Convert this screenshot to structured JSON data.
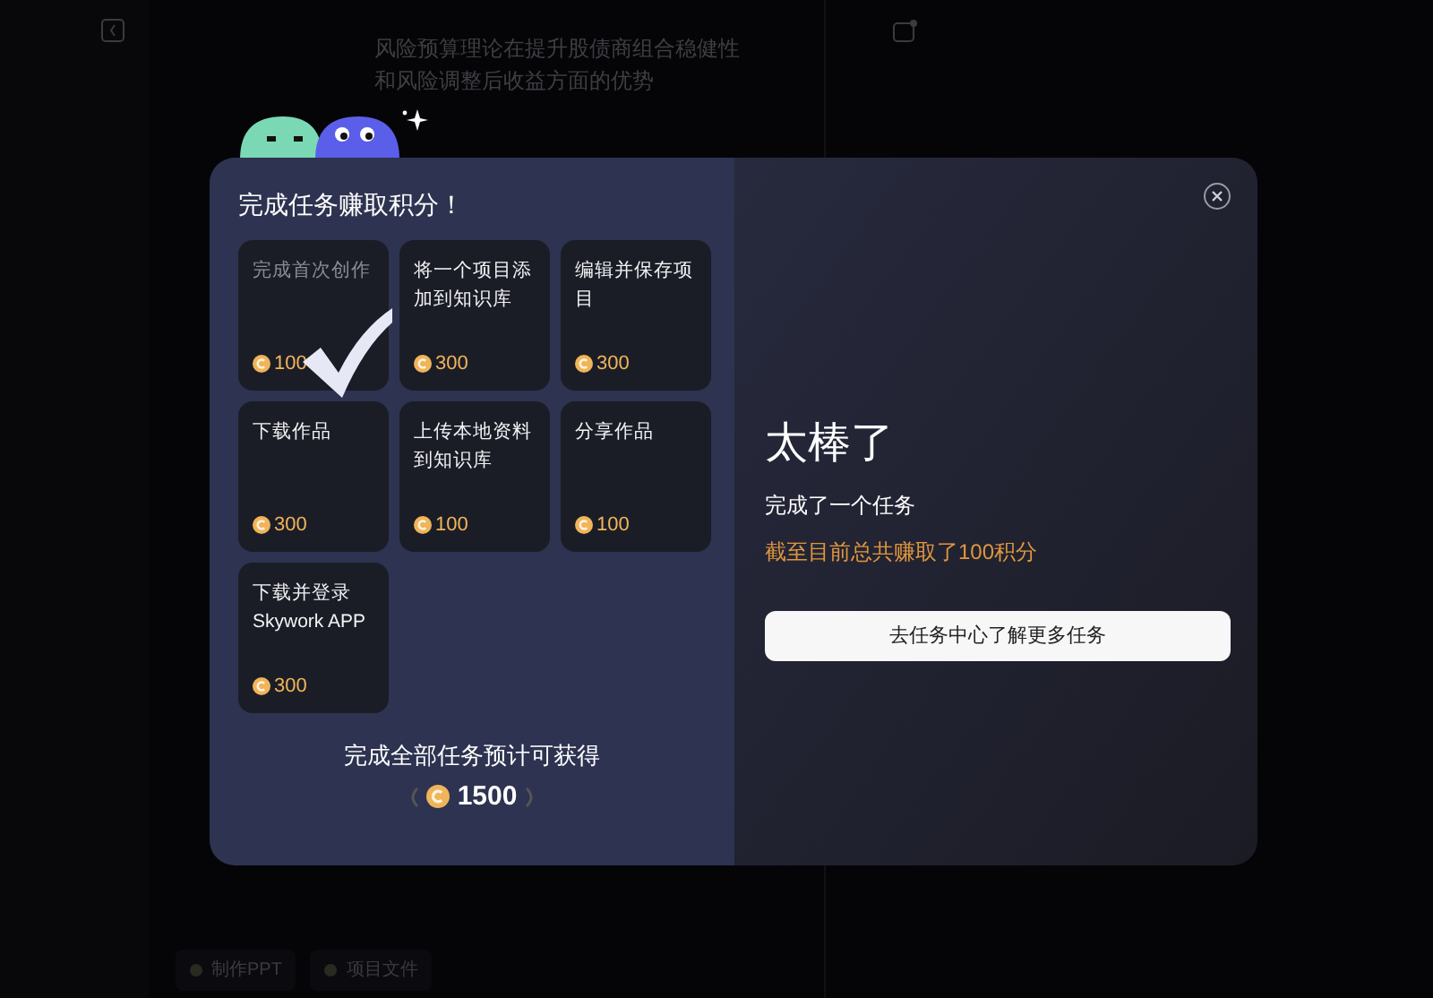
{
  "background": {
    "message": "风险预算理论在提升股债商组合稳健性和风险调整后收益方面的优势",
    "chips": [
      {
        "label": "制作PPT"
      },
      {
        "label": "项目文件"
      }
    ]
  },
  "modal": {
    "title": "完成任务赚取积分！",
    "tasks": [
      {
        "label": "完成首次创作",
        "points": "100",
        "completed": true
      },
      {
        "label": "将一个项目添加到知识库",
        "points": "300",
        "completed": false
      },
      {
        "label": "编辑并保存项目",
        "points": "300",
        "completed": false
      },
      {
        "label": "下载作品",
        "points": "300",
        "completed": false
      },
      {
        "label": "上传本地资料到知识库",
        "points": "100",
        "completed": false
      },
      {
        "label": "分享作品",
        "points": "100",
        "completed": false
      },
      {
        "label": "下载并登录 Skywork APP",
        "points": "300",
        "completed": false
      }
    ],
    "total_caption": "完成全部任务预计可获得",
    "total": "1500",
    "headline": "太棒了",
    "subtitle": "完成了一个任务",
    "earned": "截至目前总共赚取了100积分",
    "button": "去任务中心了解更多任务"
  }
}
